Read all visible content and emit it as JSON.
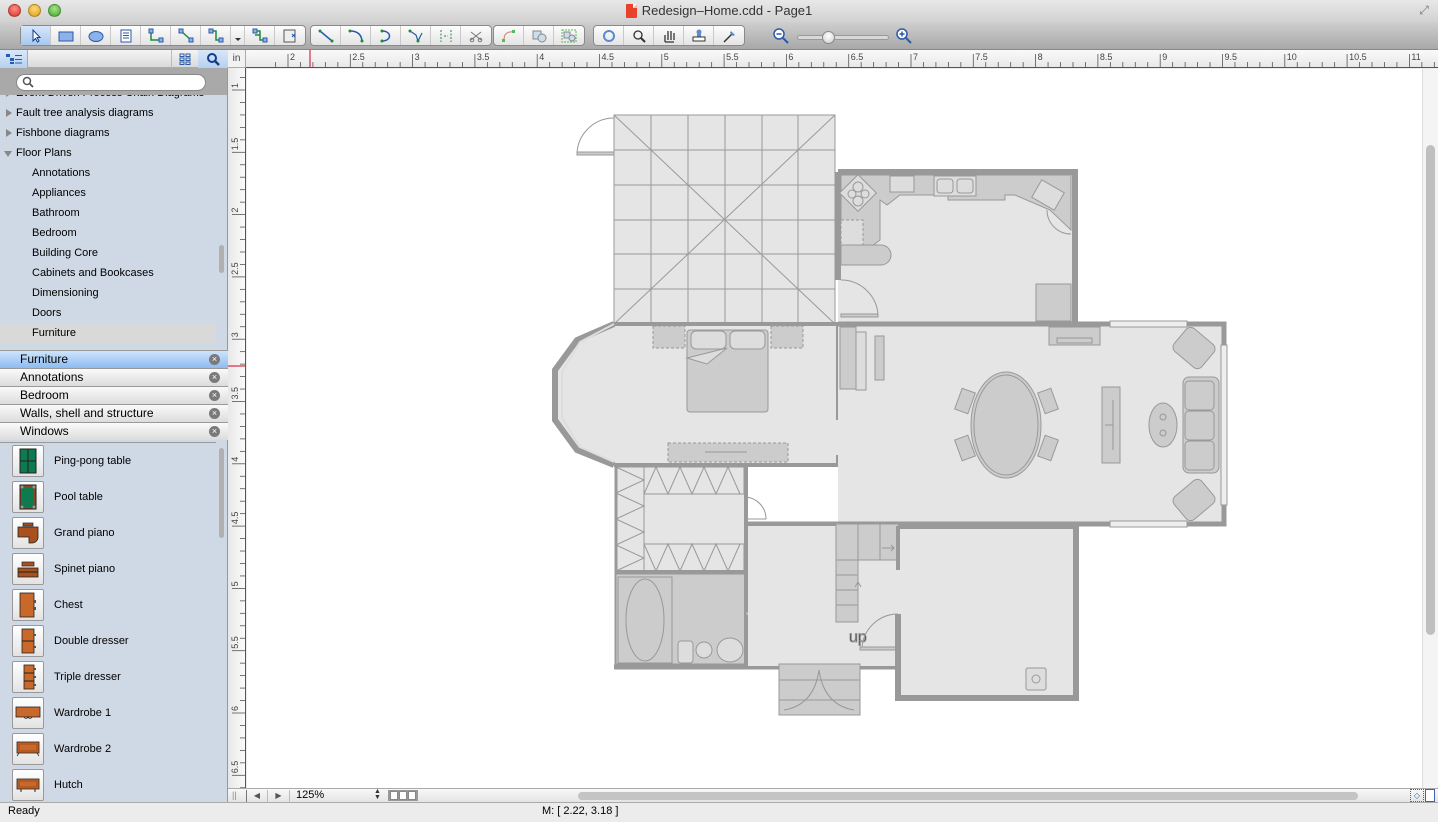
{
  "window": {
    "title": "Redesign–Home.cdd - Page1",
    "file_icon": "cdd-document-icon"
  },
  "toolbar": {
    "groups": [
      {
        "name": "drawing-tools",
        "items": [
          "select-pointer",
          "rectangle",
          "ellipse",
          "text-block",
          "orthogonal-connector",
          "straight-connector",
          "curved-connector",
          "connector-menu",
          "tree-connector",
          "insert-object"
        ]
      },
      {
        "name": "line-tools",
        "items": [
          "line",
          "arc",
          "bezier",
          "polyline",
          "spline-split",
          "cut-connector"
        ]
      },
      {
        "name": "shape-tools",
        "items": [
          "curve-edit",
          "shape-union",
          "shape-group"
        ]
      },
      {
        "name": "view-tools",
        "items": [
          "rotate",
          "zoom-magnifier",
          "pan-hand",
          "format-stamp",
          "eyedropper"
        ]
      }
    ],
    "zoom_level_fraction": 0.3
  },
  "sidebar": {
    "search": {
      "placeholder": "",
      "value": ""
    },
    "tree": [
      {
        "label": "Event-Driven Process Chain Diagrams",
        "expanded": false,
        "child": false
      },
      {
        "label": "Fault tree analysis diagrams",
        "expanded": false,
        "child": false
      },
      {
        "label": "Fishbone diagrams",
        "expanded": false,
        "child": false
      },
      {
        "label": "Floor Plans",
        "expanded": true,
        "child": false
      },
      {
        "label": "Annotations",
        "child": true
      },
      {
        "label": "Appliances",
        "child": true
      },
      {
        "label": "Bathroom",
        "child": true
      },
      {
        "label": "Bedroom",
        "child": true
      },
      {
        "label": "Building Core",
        "child": true
      },
      {
        "label": "Cabinets and Bookcases",
        "child": true
      },
      {
        "label": "Dimensioning",
        "child": true
      },
      {
        "label": "Doors",
        "child": true
      },
      {
        "label": "Furniture",
        "child": true,
        "selected": true
      }
    ],
    "open_libraries": [
      {
        "label": "Furniture",
        "active": true
      },
      {
        "label": "Annotations",
        "active": false
      },
      {
        "label": "Bedroom",
        "active": false
      },
      {
        "label": "Walls, shell and structure",
        "active": false
      },
      {
        "label": "Windows",
        "active": false
      }
    ],
    "close_glyph": "×",
    "shapes": [
      {
        "label": "Ping-pong table",
        "icon": "ping-pong-table-icon",
        "color": "#0e7a4f"
      },
      {
        "label": "Pool table",
        "icon": "pool-table-icon",
        "color": "#0e7a4f"
      },
      {
        "label": "Grand piano",
        "icon": "grand-piano-icon",
        "color": "#a9501f"
      },
      {
        "label": "Spinet piano",
        "icon": "spinet-piano-icon",
        "color": "#a9501f"
      },
      {
        "label": "Chest",
        "icon": "chest-icon",
        "color": "#c8682a"
      },
      {
        "label": "Double dresser",
        "icon": "double-dresser-icon",
        "color": "#c8682a"
      },
      {
        "label": "Triple dresser",
        "icon": "triple-dresser-icon",
        "color": "#c8682a"
      },
      {
        "label": "Wardrobe 1",
        "icon": "wardrobe-icon",
        "color": "#c8682a"
      },
      {
        "label": "Wardrobe 2",
        "icon": "wardrobe-icon",
        "color": "#c8682a"
      },
      {
        "label": "Hutch",
        "icon": "hutch-icon",
        "color": "#c8682a"
      }
    ]
  },
  "rulers": {
    "unit": "in",
    "horizontal_labels": [
      "2",
      "2.5",
      "3",
      "3.5",
      "4",
      "4.5",
      "5",
      "5.5",
      "6",
      "6.5",
      "7",
      "7.5",
      "8",
      "8.5",
      "9",
      "9.5",
      "10",
      "10.5",
      "11"
    ],
    "vertical_labels": [
      "1",
      "1.5",
      "2",
      "2.5",
      "3",
      "3.5",
      "4",
      "4.5",
      "5",
      "5.5",
      "6",
      "6.5"
    ],
    "marker_color": "#d0021b"
  },
  "canvas": {
    "floor_plan": {
      "label_up": "up",
      "wall_color": "#999999",
      "floor_color": "#e5e5e5",
      "furniture_color": "#cccccc",
      "rooms": [
        "tiled-terrace",
        "kitchen",
        "bedroom",
        "living-dining",
        "closet",
        "bathroom",
        "stair-hall",
        "garage",
        "entry-porch"
      ]
    }
  },
  "bottom_bar": {
    "zoom": "125%",
    "page_view_buttons": 3
  },
  "status": {
    "text": "Ready",
    "mouse_coords": "M: [ 2.22, 3.18 ]"
  }
}
